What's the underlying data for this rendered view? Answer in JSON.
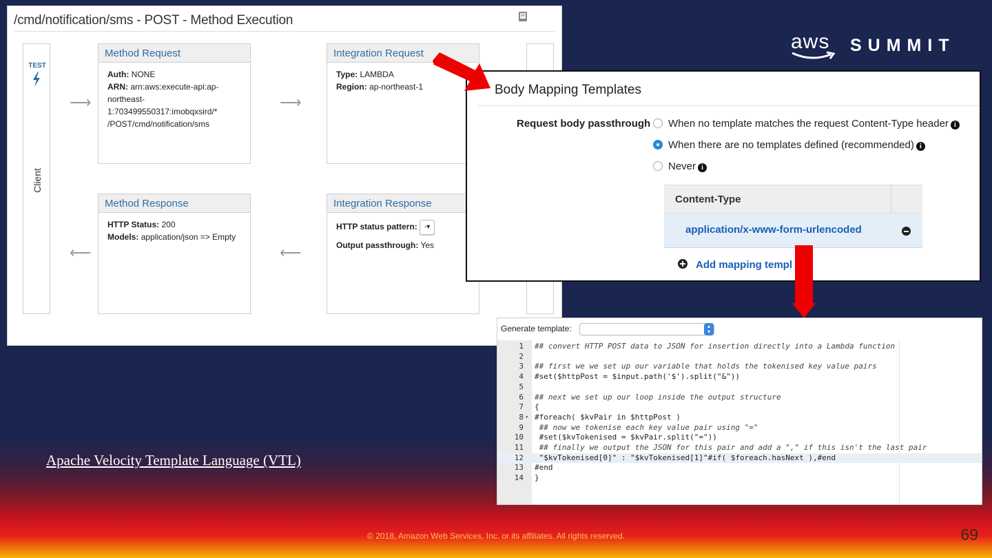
{
  "method_execution": {
    "title": "/cmd/notification/sms - POST - Method Execution",
    "client": {
      "test_label": "TEST",
      "label": "Client"
    },
    "method_request": {
      "title": "Method Request",
      "auth_label": "Auth:",
      "auth_value": "NONE",
      "arn_label": "ARN:",
      "arn_value_1": "arn:aws:execute-api:ap-",
      "arn_value_2": "northeast-",
      "arn_value_3": "1:703499550317:imobqxsird/*",
      "arn_value_4": "/POST/cmd/notification/sms"
    },
    "integration_request": {
      "title": "Integration Request",
      "type_label": "Type:",
      "type_value": "LAMBDA",
      "region_label": "Region:",
      "region_value": "ap-northeast-1"
    },
    "method_response": {
      "title": "Method Response",
      "status_label": "HTTP Status:",
      "status_value": "200",
      "models_label": "Models:",
      "models_value": "application/json => Empty"
    },
    "integration_response": {
      "title": "Integration Response",
      "pattern_label": "HTTP status pattern:",
      "pattern_value": "-",
      "passthrough_label": "Output passthrough:",
      "passthrough_value": "Yes"
    }
  },
  "body_mapping": {
    "title": "Body Mapping Templates",
    "passthrough_label": "Request body passthrough",
    "options": [
      {
        "label": "When no template matches the request Content-Type header",
        "selected": false
      },
      {
        "label": "When there are no templates defined (recommended)",
        "selected": true
      },
      {
        "label": "Never",
        "selected": false
      }
    ],
    "info_glyph": "i",
    "table_header": "Content-Type",
    "content_type": "application/x-www-form-urlencoded",
    "add_label": "Add mapping templ"
  },
  "code_editor": {
    "generate_label": "Generate template:",
    "lines": [
      {
        "n": "1",
        "text": "## convert HTTP POST data to JSON for insertion directly into a Lambda function",
        "comment": true
      },
      {
        "n": "2",
        "text": "",
        "comment": false
      },
      {
        "n": "3",
        "text": "## first we we set up our variable that holds the tokenised key value pairs",
        "comment": true
      },
      {
        "n": "4",
        "text": "#set($httpPost = $input.path('$').split(\"&\"))",
        "comment": false
      },
      {
        "n": "5",
        "text": "",
        "comment": false
      },
      {
        "n": "6",
        "text": "## next we set up our loop inside the output structure",
        "comment": true
      },
      {
        "n": "7",
        "text": "{",
        "comment": false
      },
      {
        "n": "8",
        "text": "#foreach( $kvPair in $httpPost )",
        "comment": false,
        "fold": "▾"
      },
      {
        "n": "9",
        "text": " ## now we tokenise each key value pair using \"=\"",
        "comment": true
      },
      {
        "n": "10",
        "text": " #set($kvTokenised = $kvPair.split(\"=\"))",
        "comment": false
      },
      {
        "n": "11",
        "text": " ## finally we output the JSON for this pair and add a \",\" if this isn't the last pair",
        "comment": true
      },
      {
        "n": "12",
        "text": " \"$kvTokenised[0]\" : \"$kvTokenised[1]\"#if( $foreach.hasNext ),#end",
        "comment": false,
        "active": true
      },
      {
        "n": "13",
        "text": "#end",
        "comment": false
      },
      {
        "n": "14",
        "text": "}",
        "comment": false
      }
    ]
  },
  "branding": {
    "aws": "aws",
    "summit": "SUMMIT"
  },
  "vtl_link": "Apache Velocity Template Language (VTL)",
  "footer": {
    "copyright": "© 2018, Amazon Web Services, Inc. or its affiliates. All rights reserved.",
    "page_number": "69"
  },
  "colors": {
    "background": "#1a2550",
    "link_blue": "#2e6da4",
    "highlight_red": "#ee0000"
  }
}
